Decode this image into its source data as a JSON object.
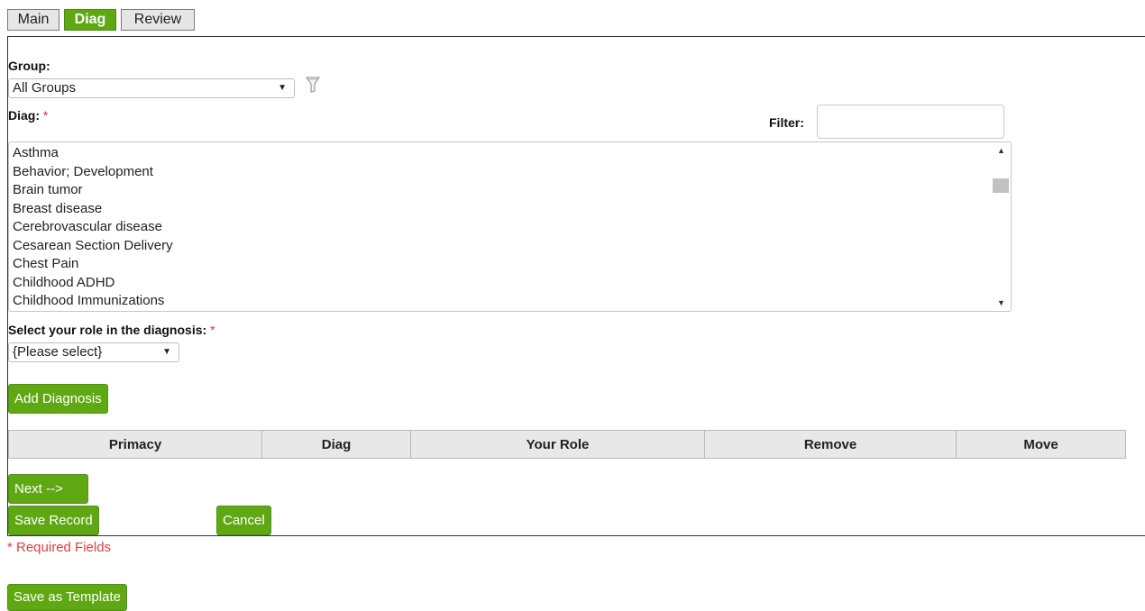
{
  "tabs": [
    {
      "label": "Main",
      "active": false
    },
    {
      "label": "Diag",
      "active": true
    },
    {
      "label": "Review",
      "active": false
    }
  ],
  "group": {
    "label": "Group:",
    "selected": "All Groups"
  },
  "diag": {
    "label": "Diag:",
    "required_mark": "*"
  },
  "filter": {
    "label": "Filter:",
    "value": ""
  },
  "diag_list": [
    "Asthma",
    "Behavior; Development",
    "Brain tumor",
    "Breast disease",
    "Cerebrovascular disease",
    "Cesarean Section Delivery",
    "Chest Pain",
    "Childhood ADHD",
    "Childhood Immunizations"
  ],
  "role": {
    "label": "Select your role in the diagnosis:",
    "required_mark": "*",
    "selected": "{Please select}"
  },
  "buttons": {
    "add_diagnosis": "Add Diagnosis",
    "next": "Next -->",
    "save_record": "Save Record",
    "cancel": "Cancel",
    "save_template": "Save as Template"
  },
  "table": {
    "headers": [
      "Primacy",
      "Diag",
      "Your Role",
      "Remove",
      "Move"
    ]
  },
  "required_note": "* Required Fields",
  "colors": {
    "accent_green": "#5fa813",
    "required_red": "#e03030"
  },
  "icons": {
    "filter": "funnel-icon",
    "dropdown": "caret-down-icon"
  }
}
